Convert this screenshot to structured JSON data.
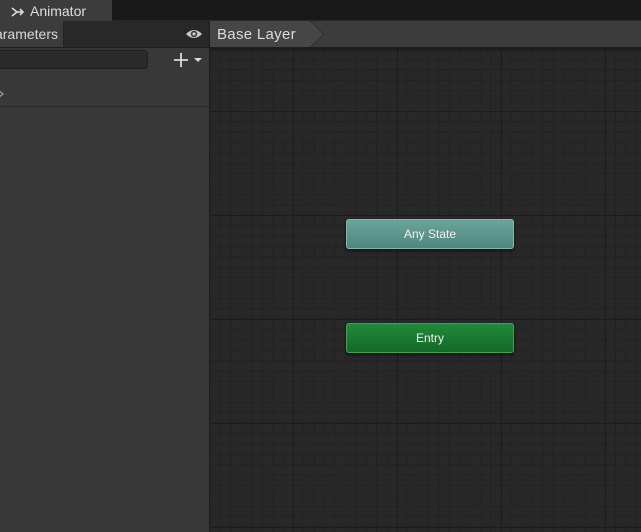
{
  "window": {
    "tab_label": "Animator"
  },
  "left_panel": {
    "tab_label": "Parameters",
    "search": {
      "value": "",
      "placeholder": ""
    },
    "row_marker": "›"
  },
  "graph": {
    "breadcrumb": "Base Layer",
    "nodes": {
      "any_state": "Any State",
      "entry": "Entry"
    }
  },
  "colors": {
    "any_state_node": "#5e988e",
    "entry_node": "#1a7a33",
    "graph_background": "#282828",
    "panel_background": "#383838"
  },
  "icons": {
    "tab": "animator-icon",
    "visibility": "eye-icon",
    "add": "plus-dropdown-icon"
  }
}
